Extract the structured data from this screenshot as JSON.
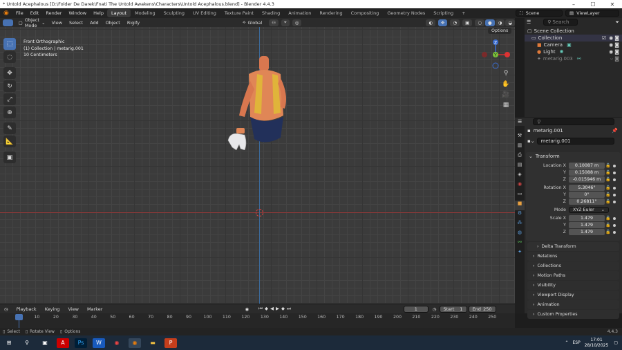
{
  "window": {
    "title": "* Untold Acephalous [D:\\Folder De Darek\\Fnati The Untold Awakens\\Characters\\Untold Acephalous.blend] - Blender 4.4.3"
  },
  "menu": [
    "File",
    "Edit",
    "Render",
    "Window",
    "Help"
  ],
  "workspaces": [
    "Layout",
    "Modeling",
    "Sculpting",
    "UV Editing",
    "Texture Paint",
    "Shading",
    "Animation",
    "Rendering",
    "Compositing",
    "Geometry Nodes",
    "Scripting",
    "+"
  ],
  "scene": {
    "scene_label": "Scene",
    "view_layer": "ViewLayer"
  },
  "viewport_header": {
    "mode": "Object Mode",
    "menus": [
      "View",
      "Select",
      "Add",
      "Object",
      "Rigify"
    ],
    "orientation": "Global",
    "options": "Options"
  },
  "viewport_info": {
    "view": "Front Orthographic",
    "collection": "(1) Collection | metarig.001",
    "scale": "10 Centimeters"
  },
  "outliner": {
    "search_placeholder": "Search",
    "items": [
      "Scene Collection",
      "Collection",
      "Camera",
      "Light",
      "metarig.003"
    ]
  },
  "properties": {
    "object_name": "metarig.001",
    "data_name": "metarig.001",
    "transform_title": "Transform",
    "location": {
      "label": "Location X",
      "x": "0.10087 m",
      "y": "0.15088 m",
      "z": "-0.015946 m"
    },
    "rotation": {
      "label": "Rotation X",
      "x": "5.3046°",
      "y": "0°",
      "z": "0.26811°"
    },
    "mode_label": "Mode",
    "mode": "XYZ Euler",
    "scale": {
      "label": "Scale X",
      "x": "1.479",
      "y": "1.479",
      "z": "1.479"
    },
    "axis": {
      "y": "Y",
      "z": "Z"
    },
    "subpanels": [
      "Delta Transform",
      "Relations",
      "Collections",
      "Motion Paths",
      "Visibility",
      "Viewport Display",
      "Animation",
      "Custom Properties"
    ]
  },
  "timeline": {
    "menus": [
      "Playback",
      "Keying",
      "View",
      "Marker"
    ],
    "current_frame": "1",
    "start_label": "Start",
    "start": "1",
    "end_label": "End",
    "end": "250",
    "ticks": [
      "0",
      "10",
      "20",
      "30",
      "40",
      "50",
      "60",
      "70",
      "80",
      "90",
      "100",
      "110",
      "120",
      "130",
      "140",
      "150",
      "160",
      "170",
      "180",
      "190",
      "200",
      "210",
      "220",
      "230",
      "240",
      "250"
    ]
  },
  "status": {
    "select": "Select",
    "rotate": "Rotate View",
    "options": "Options",
    "version": "4.4.3"
  },
  "taskbar": {
    "lang": "ESP",
    "time": "17:01",
    "date": "28/10/2025"
  },
  "colors": {
    "accent": "#4772b3",
    "x_axis": "#9a3a3a",
    "y_axis": "#3c6a9a"
  }
}
